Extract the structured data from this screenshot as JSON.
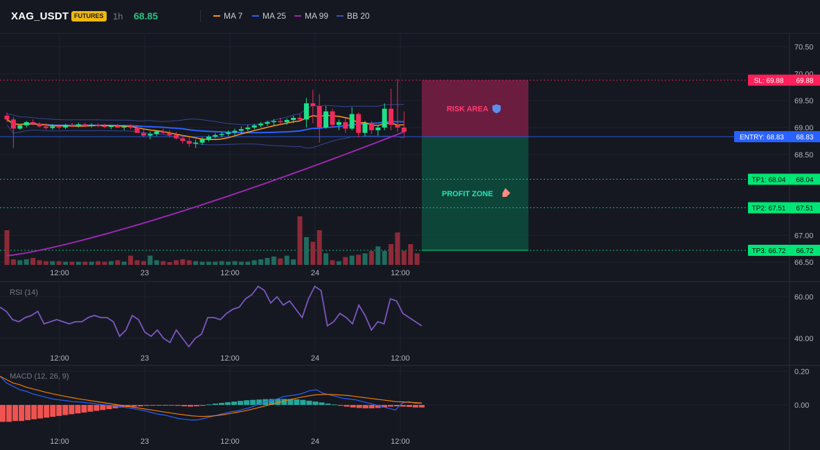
{
  "header": {
    "symbol": "XAG_USDT",
    "badge": "FUTURES",
    "interval": "1h",
    "last_price": "68.85",
    "indicators": [
      {
        "label": "MA 7",
        "color": "#f7931a"
      },
      {
        "label": "MA 25",
        "color": "#2962ff"
      },
      {
        "label": "MA 99",
        "color": "#9c27b0"
      },
      {
        "label": "BB 20",
        "color": "#3f51b5"
      }
    ]
  },
  "colors": {
    "up": "#26a69a",
    "up_candle": "#1ee08a",
    "down": "#ef2b5a",
    "vol_up": "#1f6b5e",
    "vol_down": "#8e2a38",
    "ma7": "#f7931a",
    "ma25": "#2962ff",
    "ma99": "#9c27b0",
    "bb": "#3f51b5",
    "rsi": "#7e57c2",
    "macd": "#2962ff",
    "signal": "#f57c00",
    "hist_up": "#26a69a",
    "hist_down": "#ef5350"
  },
  "chart_data": [
    {
      "type": "candlestick",
      "title": "XAG_USDT 1h",
      "x_ticks": [
        "12:00",
        "23",
        "12:00",
        "24",
        "12:00"
      ],
      "y_ticks": [
        70.5,
        70.0,
        69.5,
        69.0,
        68.5,
        67.0,
        66.5
      ],
      "ylim": [
        66.45,
        70.75
      ],
      "ohlc": [
        [
          69.22,
          69.28,
          69.1,
          69.15
        ],
        [
          69.15,
          69.2,
          68.62,
          68.98
        ],
        [
          68.98,
          69.05,
          68.96,
          69.04
        ],
        [
          69.04,
          69.12,
          69.0,
          69.1
        ],
        [
          69.1,
          69.15,
          69.04,
          69.07
        ],
        [
          69.07,
          69.1,
          69.0,
          69.02
        ],
        [
          69.02,
          69.08,
          68.96,
          68.99
        ],
        [
          68.99,
          69.06,
          68.96,
          69.02
        ],
        [
          69.02,
          69.06,
          68.97,
          69.0
        ],
        [
          69.0,
          69.07,
          68.97,
          69.05
        ],
        [
          69.05,
          69.09,
          69.01,
          69.04
        ],
        [
          69.04,
          69.09,
          69.0,
          69.06
        ],
        [
          69.06,
          69.09,
          69.01,
          69.03
        ],
        [
          69.03,
          69.08,
          69.0,
          69.05
        ],
        [
          69.05,
          69.08,
          69.01,
          69.03
        ],
        [
          69.03,
          69.07,
          68.99,
          69.01
        ],
        [
          69.01,
          69.05,
          68.97,
          69.03
        ],
        [
          69.03,
          69.07,
          68.99,
          69.0
        ],
        [
          69.0,
          69.05,
          68.95,
          69.02
        ],
        [
          69.02,
          69.06,
          68.97,
          69.0
        ],
        [
          69.0,
          69.05,
          68.93,
          68.9
        ],
        [
          68.9,
          68.96,
          68.82,
          68.85
        ],
        [
          68.85,
          68.93,
          68.78,
          68.88
        ],
        [
          68.88,
          68.95,
          68.84,
          68.93
        ],
        [
          68.93,
          68.98,
          68.88,
          68.9
        ],
        [
          68.9,
          68.95,
          68.82,
          68.86
        ],
        [
          68.86,
          68.92,
          68.78,
          68.8
        ],
        [
          68.8,
          68.86,
          68.7,
          68.75
        ],
        [
          68.75,
          68.82,
          68.64,
          68.7
        ],
        [
          68.7,
          68.78,
          68.62,
          68.72
        ],
        [
          68.72,
          68.82,
          68.68,
          68.78
        ],
        [
          68.78,
          68.86,
          68.74,
          68.83
        ],
        [
          68.83,
          68.9,
          68.8,
          68.86
        ],
        [
          68.86,
          68.92,
          68.82,
          68.88
        ],
        [
          68.88,
          68.95,
          68.84,
          68.91
        ],
        [
          68.91,
          68.98,
          68.86,
          68.94
        ],
        [
          68.94,
          69.02,
          68.9,
          68.97
        ],
        [
          68.97,
          69.05,
          68.93,
          69.0
        ],
        [
          69.0,
          69.07,
          68.96,
          69.04
        ],
        [
          69.04,
          69.1,
          69.0,
          69.07
        ],
        [
          69.07,
          69.13,
          69.03,
          69.1
        ],
        [
          69.1,
          69.16,
          69.04,
          69.12
        ],
        [
          69.12,
          69.18,
          69.06,
          69.1
        ],
        [
          69.1,
          69.17,
          69.05,
          69.14
        ],
        [
          69.14,
          69.22,
          69.08,
          69.18
        ],
        [
          69.18,
          69.25,
          69.1,
          69.15
        ],
        [
          69.15,
          69.55,
          69.0,
          69.45
        ],
        [
          69.45,
          69.7,
          69.08,
          69.4
        ],
        [
          69.4,
          69.62,
          68.72,
          69.0
        ],
        [
          69.0,
          69.4,
          68.98,
          69.3
        ],
        [
          69.3,
          69.35,
          69.0,
          69.05
        ],
        [
          69.05,
          69.15,
          68.95,
          69.1
        ],
        [
          69.1,
          69.18,
          68.9,
          68.98
        ],
        [
          68.98,
          69.38,
          68.95,
          69.25
        ],
        [
          69.25,
          69.28,
          68.82,
          68.9
        ],
        [
          68.9,
          69.12,
          68.84,
          69.08
        ],
        [
          69.08,
          69.12,
          68.88,
          68.95
        ],
        [
          68.95,
          69.05,
          68.85,
          69.0
        ],
        [
          69.0,
          69.45,
          68.95,
          69.35
        ],
        [
          69.35,
          69.72,
          68.95,
          69.05
        ],
        [
          69.05,
          69.9,
          68.92,
          69.0
        ],
        [
          69.0,
          69.3,
          68.82,
          68.92
        ]
      ],
      "volume": [
        0.75,
        0.12,
        0.1,
        0.12,
        0.15,
        0.1,
        0.08,
        0.08,
        0.08,
        0.07,
        0.07,
        0.07,
        0.07,
        0.07,
        0.08,
        0.07,
        0.08,
        0.1,
        0.07,
        0.2,
        0.1,
        0.08,
        0.2,
        0.1,
        0.08,
        0.06,
        0.1,
        0.12,
        0.1,
        0.08,
        0.07,
        0.07,
        0.07,
        0.08,
        0.07,
        0.08,
        0.07,
        0.07,
        0.1,
        0.12,
        0.15,
        0.18,
        0.14,
        0.2,
        0.12,
        1.05,
        0.6,
        0.5,
        0.75,
        0.25,
        0.1,
        0.08,
        0.17,
        0.2,
        0.22,
        0.25,
        0.3,
        0.4,
        0.3,
        0.45,
        0.7,
        0.3,
        0.45,
        0.25
      ]
    },
    {
      "type": "line",
      "title": "RSI (14)",
      "x_ticks": [
        "12:00",
        "23",
        "12:00",
        "24",
        "12:00"
      ],
      "y_ticks": [
        60.0,
        40.0
      ],
      "ylim": [
        34,
        67
      ],
      "values": [
        55,
        53,
        49,
        48,
        50,
        51,
        53,
        47,
        48,
        49,
        48,
        47,
        48,
        48,
        50,
        51,
        50,
        50,
        48,
        41,
        44,
        51,
        49,
        43,
        41,
        44,
        40,
        38,
        44,
        40,
        36,
        40,
        42,
        50,
        50,
        49,
        52,
        54,
        55,
        59,
        61,
        65,
        63,
        57,
        60,
        56,
        58,
        54,
        50,
        59,
        65,
        63,
        46,
        48,
        52,
        50,
        47,
        56,
        51,
        44,
        48,
        47,
        59,
        58,
        52,
        50,
        48,
        46
      ]
    },
    {
      "type": "bar+line",
      "title": "MACD (12, 26, 9)",
      "x_ticks": [
        "12:00",
        "23",
        "12:00",
        "24",
        "12:00"
      ],
      "y_ticks": [
        0.2,
        0.0
      ],
      "ylim": [
        -0.16,
        0.23
      ],
      "histogram": [
        -0.1,
        -0.1,
        -0.095,
        -0.095,
        -0.09,
        -0.085,
        -0.08,
        -0.075,
        -0.07,
        -0.065,
        -0.06,
        -0.055,
        -0.05,
        -0.045,
        -0.04,
        -0.035,
        -0.03,
        -0.025,
        -0.02,
        -0.015,
        -0.012,
        -0.01,
        -0.008,
        -0.005,
        -0.003,
        -0.002,
        -0.002,
        -0.003,
        -0.005,
        -0.008,
        -0.01,
        -0.008,
        -0.005,
        0.003,
        0.008,
        0.012,
        0.016,
        0.02,
        0.024,
        0.028,
        0.03,
        0.032,
        0.034,
        0.035,
        0.036,
        0.036,
        0.035,
        0.033,
        0.03,
        0.025,
        0.02,
        0.015,
        0.008,
        0.003,
        -0.005,
        -0.01,
        -0.015,
        -0.018,
        -0.02,
        -0.02,
        -0.018,
        -0.015,
        -0.01,
        -0.008,
        -0.01,
        -0.012,
        -0.015,
        -0.015
      ],
      "macd": [
        0.17,
        0.13,
        0.11,
        0.09,
        0.08,
        0.065,
        0.055,
        0.045,
        0.035,
        0.03,
        0.025,
        0.02,
        0.018,
        0.014,
        0.01,
        0.004,
        0.0,
        -0.004,
        -0.008,
        -0.015,
        -0.02,
        -0.028,
        -0.035,
        -0.045,
        -0.055,
        -0.06,
        -0.07,
        -0.08,
        -0.085,
        -0.09,
        -0.088,
        -0.08,
        -0.07,
        -0.06,
        -0.05,
        -0.04,
        -0.035,
        -0.025,
        -0.015,
        0.0,
        0.015,
        0.025,
        0.035,
        0.05,
        0.055,
        0.06,
        0.07,
        0.085,
        0.09,
        0.07,
        0.06,
        0.05,
        0.04,
        0.035,
        0.03,
        0.02,
        0.01,
        0.0,
        -0.01,
        -0.02,
        -0.03,
        0.01,
        0.02,
        0.01,
        0.01
      ],
      "signal": [
        0.17,
        0.15,
        0.13,
        0.12,
        0.105,
        0.095,
        0.085,
        0.075,
        0.066,
        0.058,
        0.05,
        0.043,
        0.036,
        0.03,
        0.024,
        0.018,
        0.012,
        0.006,
        0.0,
        -0.006,
        -0.012,
        -0.018,
        -0.024,
        -0.03,
        -0.036,
        -0.042,
        -0.048,
        -0.054,
        -0.059,
        -0.064,
        -0.067,
        -0.068,
        -0.066,
        -0.062,
        -0.057,
        -0.05,
        -0.043,
        -0.036,
        -0.028,
        -0.018,
        -0.008,
        0.002,
        0.012,
        0.022,
        0.032,
        0.04,
        0.048,
        0.055,
        0.06,
        0.062,
        0.062,
        0.06,
        0.058,
        0.055,
        0.05,
        0.045,
        0.04,
        0.035,
        0.03,
        0.025,
        0.02,
        0.018,
        0.016,
        0.014,
        0.012
      ]
    }
  ],
  "trade_setup": {
    "sl": {
      "label": "SL: 69.88",
      "price": 69.88,
      "axis": "69.88",
      "color": "#ff1f5a"
    },
    "entry": {
      "label": "ENTRY: 68.83",
      "price": 68.83,
      "axis": "68.83",
      "color": "#2962ff"
    },
    "tp1": {
      "label": "TP1: 68.04",
      "price": 68.04,
      "axis": "68.04",
      "color": "#00e676"
    },
    "tp2": {
      "label": "TP2: 67.51",
      "price": 67.51,
      "axis": "67.51",
      "color": "#00e676"
    },
    "tp3": {
      "label": "TP3: 66.72",
      "price": 66.72,
      "axis": "66.72",
      "color": "#00e676"
    },
    "risk_label": "RISK AREA",
    "profit_label": "PROFIT ZONE",
    "risk_color": "#7a1f45",
    "profit_color": "#0d4d3d"
  }
}
